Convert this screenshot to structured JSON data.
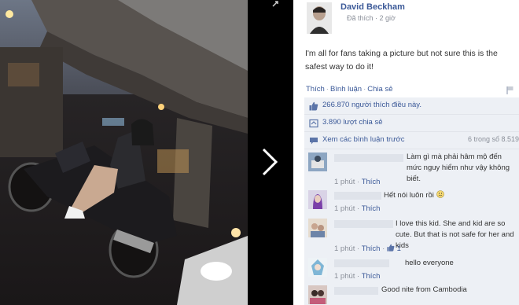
{
  "post": {
    "author": "David Beckham",
    "meta": "Đã thích · 2 giờ",
    "caption": "I'm all for fans taking a picture but not sure this is the safest way to do it!"
  },
  "actions": {
    "like": "Thích",
    "comment": "Bình luận",
    "share": "Chia sẻ"
  },
  "stats": {
    "likes": "266.870 người thích điều này.",
    "shares": "3.890 lượt chia sẻ",
    "view_previous": "Xem các bình luận trước",
    "count": "6 trong số 8.519"
  },
  "comments": [
    {
      "text": "Làm gì mà phải hâm mộ đến mức nguy hiểm như vậy không biết.",
      "time": "1 phút",
      "like": "Thích",
      "likes": ""
    },
    {
      "text": "Hết nói luôn rồi",
      "time": "1 phút",
      "like": "Thích",
      "likes": ""
    },
    {
      "text": "I love this kid. She and kid are so cute. But that is not safe for her and kids",
      "time": "1 phút",
      "like": "Thích",
      "likes": "1"
    },
    {
      "text": "hello everyone",
      "time": "1 phút",
      "like": "Thích",
      "likes": ""
    },
    {
      "text": "Good nite from Cambodia",
      "time": "",
      "like": "",
      "likes": ""
    }
  ],
  "icons": {
    "next": "chevron-right-icon",
    "expand": "expand-icon",
    "flag": "flag-icon",
    "like": "thumbs-up-icon",
    "share": "share-icon",
    "comments": "speech-bubble-icon",
    "smiley": "smiley-icon"
  },
  "colors": {
    "link": "#3b5998",
    "ufi_bg": "#edf0f5",
    "text": "#333333",
    "muted": "#8a8f99"
  }
}
